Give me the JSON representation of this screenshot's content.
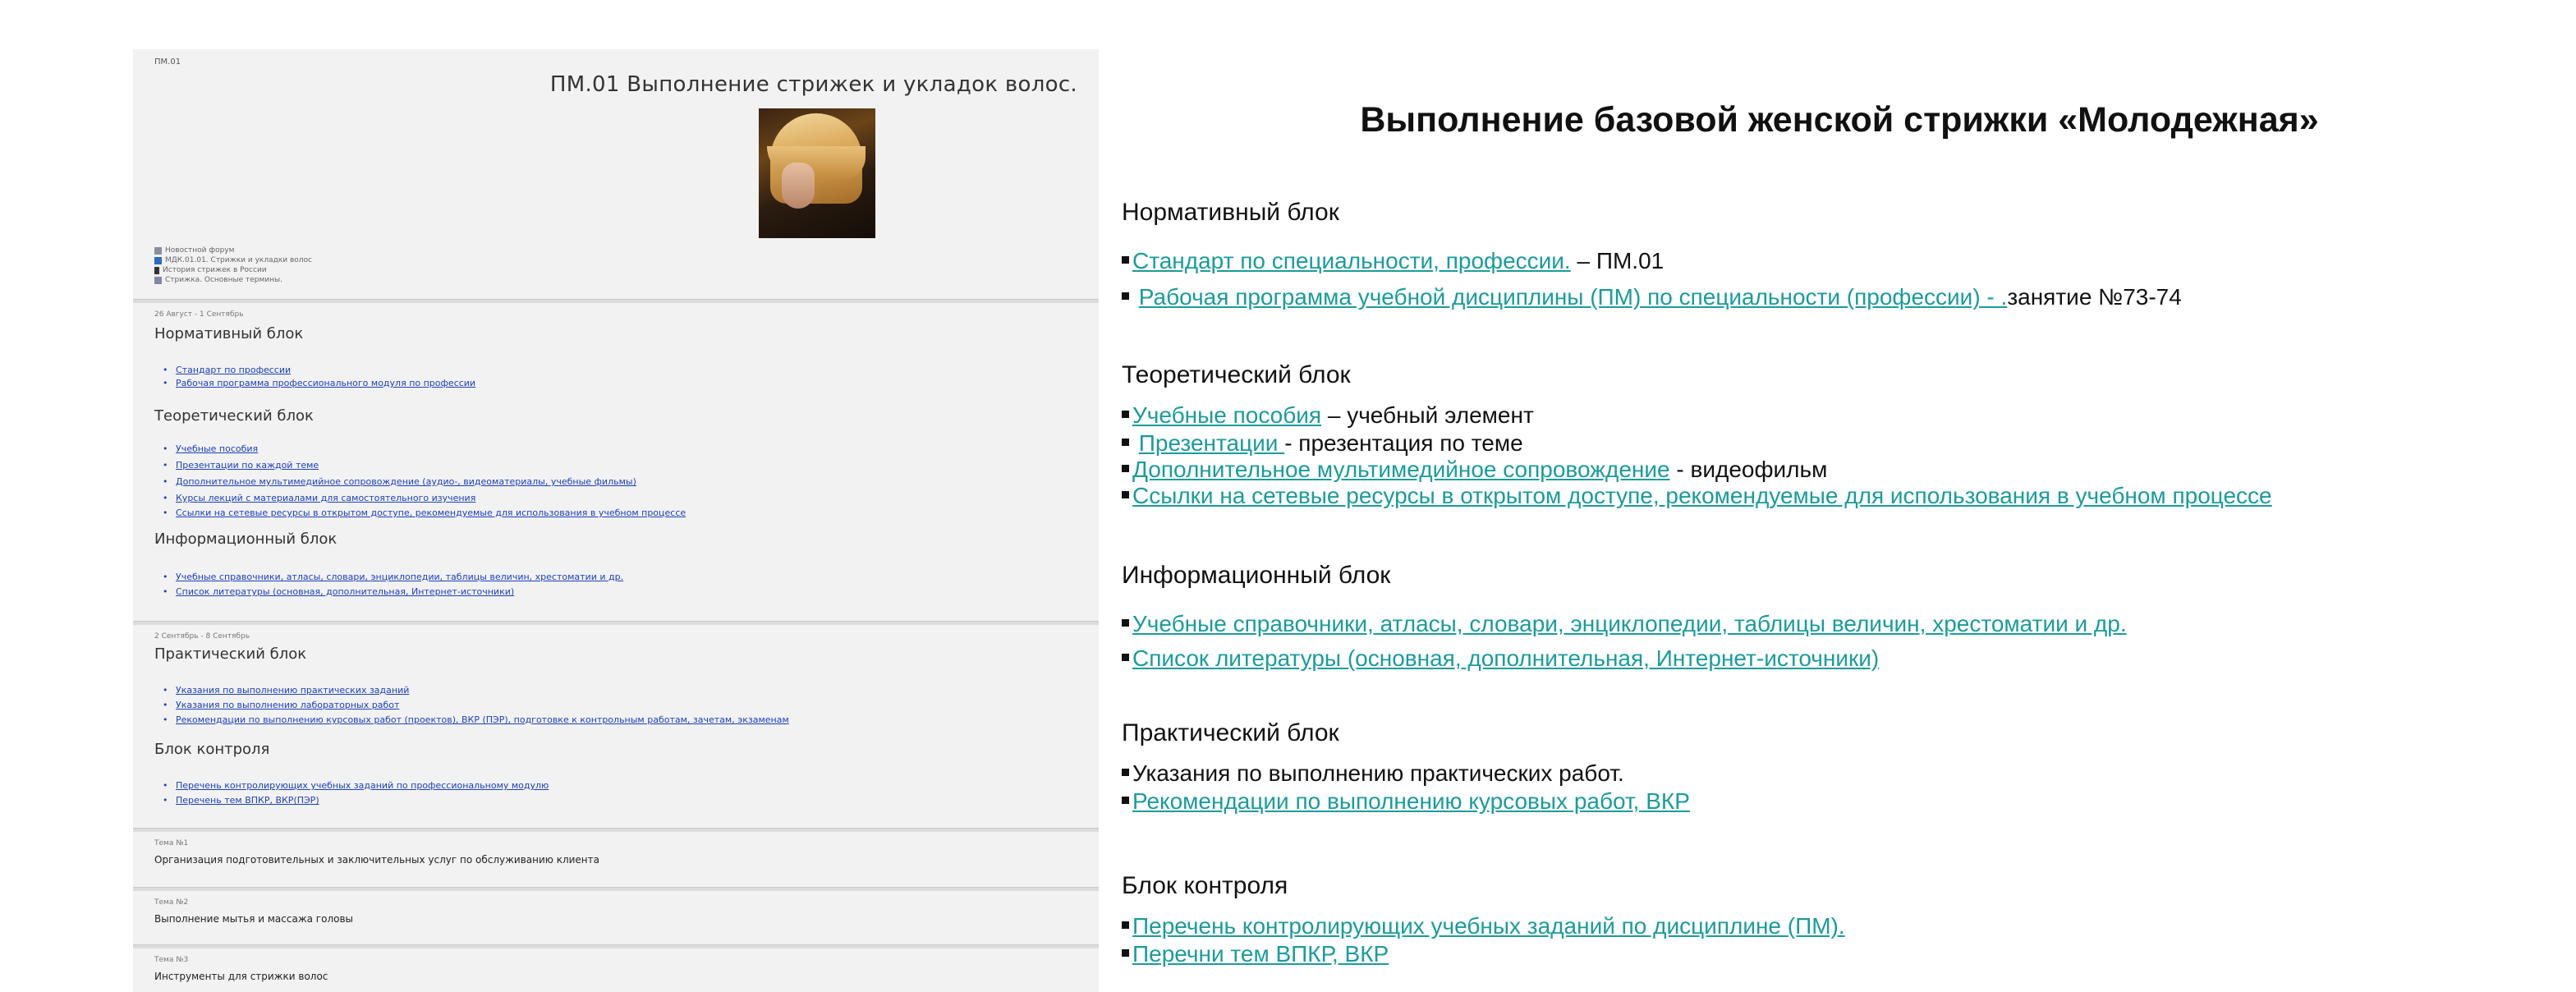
{
  "left": {
    "breadcrumb": "ПМ.01",
    "course_title": "ПМ.01 Выполнение стрижек  и укладок волос.",
    "resources": [
      {
        "icon": "forum-icon",
        "label": "Новостной форум"
      },
      {
        "icon": "doc-icon",
        "label": "МДК.01.01. Стрижки и укладки волос"
      },
      {
        "icon": "file-icon",
        "label": "История стрижек в России"
      },
      {
        "icon": "presentation-icon",
        "label": "Стрижка. Основные термины."
      }
    ],
    "week1": {
      "date": "26 Август - 1 Сентябрь",
      "normative_heading": "Нормативный блок",
      "normative_links": [
        "Стандарт по профессии",
        "Рабочая программа профессионального модуля по профессии"
      ],
      "theory_heading": "Теоретический блок",
      "theory_links": [
        "Учебные пособия",
        "Презентации по каждой теме",
        "Дополнительное мультимедийное сопровождение (аудио-, видеоматериалы, учебные фильмы)",
        "Курсы лекций с материалами для самостоятельного изучения",
        "Ссылки на сетевые ресурсы в открытом доступе, рекомендуемые для использования в учебном процессе"
      ],
      "info_heading": "Информационный блок",
      "info_links": [
        "Учебные справочники, атласы, словари, энциклопедии, таблицы величин, хрестоматии и др.",
        "Список литературы (основная, дополнительная, Интернет-источники)"
      ]
    },
    "week2": {
      "date": "2 Сентябрь - 8 Сентябрь",
      "practice_heading": "Практический блок",
      "practice_links": [
        "Указания по выполнению практических заданий",
        "Указания по выполнению лабораторных работ",
        "Рекомендации по выполнению курсовых работ (проектов), ВКР (ПЭР), подготовке к контрольным работам, зачетам, экзаменам"
      ],
      "control_heading": "Блок контроля",
      "control_links": [
        "Перечень контролирующих  учебных заданий по профессиональному модулю",
        "Перечень тем ВПКР, ВКР(ПЭР)"
      ]
    },
    "topics": [
      {
        "label": "Тема №1",
        "title": "Организация подготовительных и заключительных услуг по обслуживанию клиента"
      },
      {
        "label": "Тема №2",
        "title": "Выполнение мытья и массажа головы"
      },
      {
        "label": "Тема №3",
        "title": "Инструменты для  стрижки волос"
      }
    ]
  },
  "slide": {
    "title": "Выполнение базовой женской стрижки «Молодежная»",
    "normative": {
      "heading": "Нормативный блок",
      "r1_link": "Стандарт по специальности, профессии.",
      "r1_text": " – ПМ.01",
      "r2_link": "Рабочая программа учебной дисциплины (ПМ) по специальности (профессии) - .",
      "r2_text": "занятие №73-74"
    },
    "theory": {
      "heading": "Теоретический блок",
      "r1_link": "Учебные пособия",
      "r1_text": " – учебный элемент",
      "r2_link": "Презентации ",
      "r2_text": " - презентация по теме",
      "r3_link": "Дополнительное мультимедийное сопровождение",
      "r3_text": " - видеофильм",
      "r4_link": "Ссылки на сетевые ресурсы в открытом доступе, рекомендуемые для использования в учебном процессе "
    },
    "info": {
      "heading": "Информационный  блок",
      "r1_link": "Учебные справочники, атласы, словари, энциклопедии, таблицы величин, хрестоматии и др.",
      "r2_link": "Список литературы (основная, дополнительная, Интернет-источники)"
    },
    "practice": {
      "heading": "Практический блок",
      "r1_text": "Указания по выполнению практических работ.",
      "r2_link": "Рекомендации по выполнению курсовых работ, ВКР"
    },
    "control": {
      "heading": "Блок контроля",
      "r1_link": "Перечень контролирующих  учебных заданий по дисциплине (ПМ).",
      "r2_link": "Перечни тем ВПКР, ВКР"
    }
  }
}
